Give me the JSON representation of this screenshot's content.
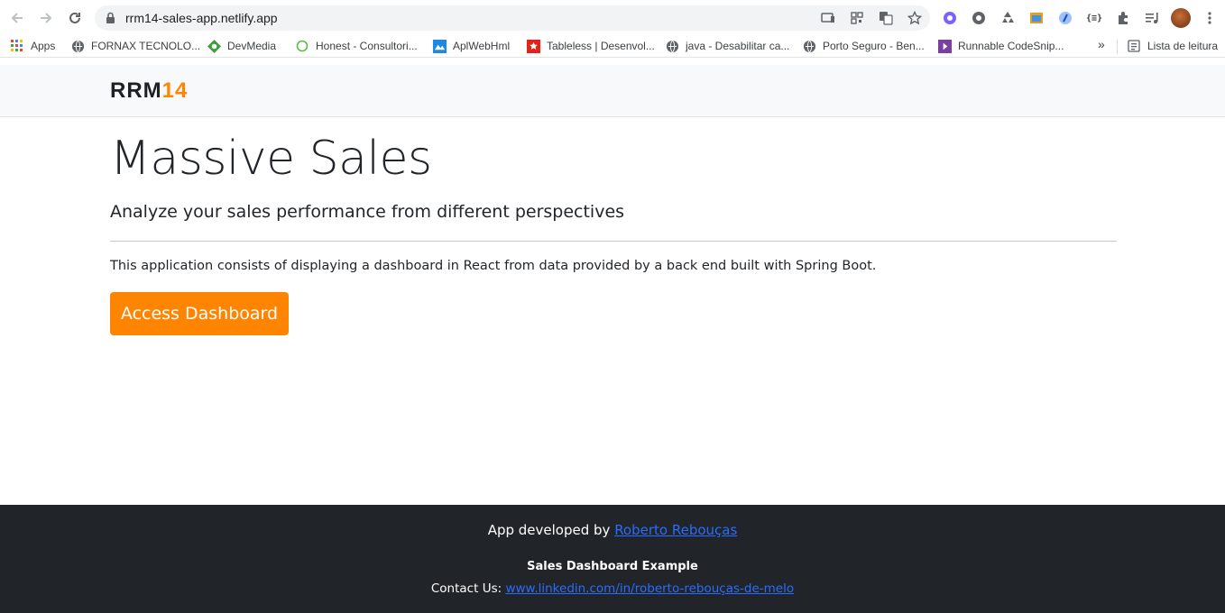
{
  "browser": {
    "url": "rrm14-sales-app.netlify.app",
    "bookmarks": [
      {
        "label": "Apps",
        "icon": "apps-grid-icon"
      },
      {
        "label": "FORNAX TECNOLO...",
        "icon": "globe-icon"
      },
      {
        "label": "DevMedia",
        "icon": "devmedia-icon"
      },
      {
        "label": "Honest - Consultori...",
        "icon": "circle-icon"
      },
      {
        "label": "AplWebHml",
        "icon": "aplwebhml-icon"
      },
      {
        "label": "Tableless | Desenvol...",
        "icon": "tableless-icon"
      },
      {
        "label": "java - Desabilitar ca...",
        "icon": "globe-icon"
      },
      {
        "label": "Porto Seguro - Ben...",
        "icon": "globe-icon"
      },
      {
        "label": "Runnable CodeSnip...",
        "icon": "runnable-icon"
      }
    ],
    "overflow": "»",
    "reading_list": "Lista de leitura"
  },
  "navbar": {
    "logo_part1": "RRM",
    "logo_part2": "14"
  },
  "main": {
    "title": "Massive Sales",
    "subtitle": "Analyze your sales performance from different perspectives",
    "description": "This application consists of displaying a dashboard in React from data provided by a back end built with Spring Boot.",
    "button_label": "Access Dashboard"
  },
  "footer": {
    "developed_by": "App developed by",
    "author": "Roberto Rebouças",
    "project": "Sales Dashboard Example",
    "contact_label": "Contact Us:",
    "contact_link": "www.linkedin.com/in/roberto-rebouças-de-melo"
  },
  "colors": {
    "accent": "#ff8400",
    "footer_bg": "#212529",
    "link": "#2a6cff",
    "navbar_bg": "#f8f9fa"
  }
}
